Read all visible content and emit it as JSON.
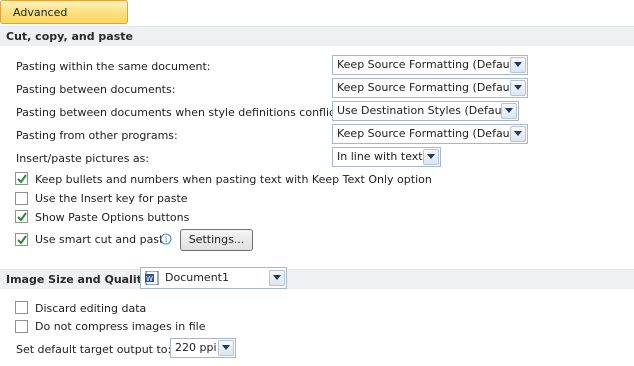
{
  "tab": {
    "label": "Advanced"
  },
  "sections": {
    "cut_copy_paste": "Cut, copy, and paste",
    "image_size_quality": "Image Size and Quality"
  },
  "paste_options": [
    {
      "label": "Pasting within the same document:",
      "value": "Keep Source Formatting (Default)"
    },
    {
      "label": "Pasting between documents:",
      "value": "Keep Source Formatting (Default)"
    },
    {
      "label": "Pasting between documents when style definitions conflict:",
      "value": "Use Destination Styles (Default)"
    },
    {
      "label": "Pasting from other programs:",
      "value": "Keep Source Formatting (Default)"
    },
    {
      "label": "Insert/paste pictures as:",
      "value": "In line with text"
    }
  ],
  "checkboxes": [
    {
      "label": "Keep bullets and numbers when pasting text with Keep Text Only option",
      "checked": true
    },
    {
      "label": "Use the Insert key for paste",
      "checked": false
    },
    {
      "label": "Show Paste Options buttons",
      "checked": true
    },
    {
      "label": "Use smart cut and paste",
      "checked": true
    }
  ],
  "settings_button": {
    "label": "Settings..."
  },
  "image_quality": {
    "document": "Document1",
    "discard_label": "Discard editing data",
    "discard_checked": false,
    "no_compress_label": "Do not compress images in file",
    "no_compress_checked": false,
    "target_output_label": "Set default target output to:",
    "target_output_value": "220 ppi"
  },
  "colors": {
    "tab_gold": "#fbd462",
    "section_bg": "#eef0f4",
    "check_green": "#2d8a2d"
  },
  "icons": [
    "chevron-down-icon",
    "check-icon",
    "info-icon",
    "word-document-icon"
  ]
}
